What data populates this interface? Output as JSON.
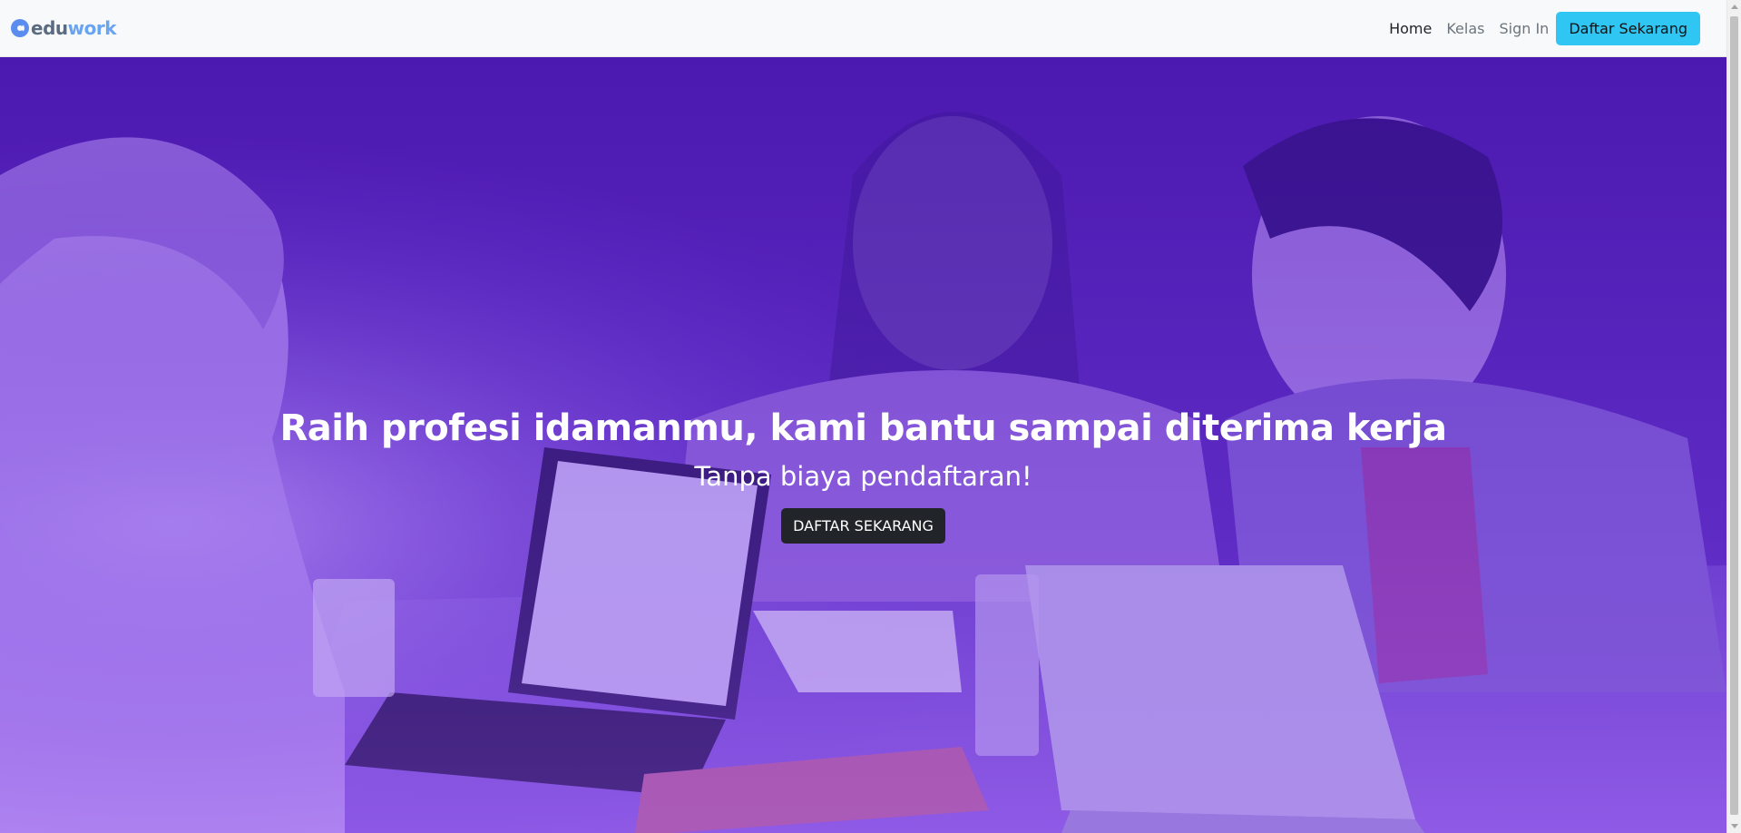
{
  "navbar": {
    "brand": {
      "prefix": "edu",
      "suffix": "work",
      "logo_icon": "eduwork-logo-icon"
    },
    "links": [
      {
        "label": "Home",
        "active": true
      },
      {
        "label": "Kelas",
        "active": false
      },
      {
        "label": "Sign In",
        "active": false
      }
    ],
    "cta_label": "Daftar Sekarang"
  },
  "hero": {
    "title": "Raih profesi idamanmu, kami bantu sampai diterima kerja",
    "subtitle": "Tanpa biaya pendaftaran!",
    "button_label": "DAFTAR SEKARANG",
    "overlay_color": "#6a38d4"
  },
  "colors": {
    "accent": "#2fc6f4",
    "dark_button": "#212529",
    "brand_blue": "#6aa4f0"
  }
}
